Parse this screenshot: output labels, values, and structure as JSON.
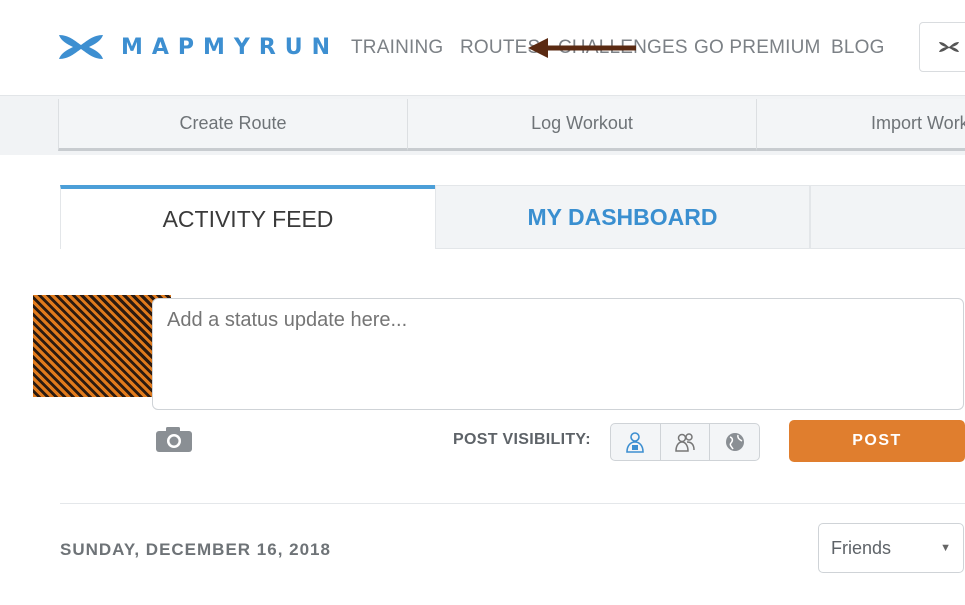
{
  "brand": {
    "name": "MAPMYRUN",
    "color": "#3d8fd1"
  },
  "nav": {
    "items": [
      "TRAINING",
      "ROUTES",
      "CHALLENGES",
      "GO PREMIUM",
      "BLOG"
    ]
  },
  "actions": [
    "Create Route",
    "Log Workout",
    "Import Work"
  ],
  "tabs": {
    "activity": "ACTIVITY FEED",
    "dashboard": "MY DASHBOARD"
  },
  "composer": {
    "placeholder": "Add a status update here...",
    "visibility_label": "POST VISIBILITY:",
    "visibility_options": [
      "private-icon",
      "friends-icon",
      "public-icon"
    ],
    "post_label": "POST",
    "post_color": "#e07e2e"
  },
  "feed": {
    "date": "SUNDAY, DECEMBER 16, 2018",
    "filter": {
      "selected": "Friends"
    }
  },
  "annotation": {
    "arrow_color": "#5a2a12"
  }
}
